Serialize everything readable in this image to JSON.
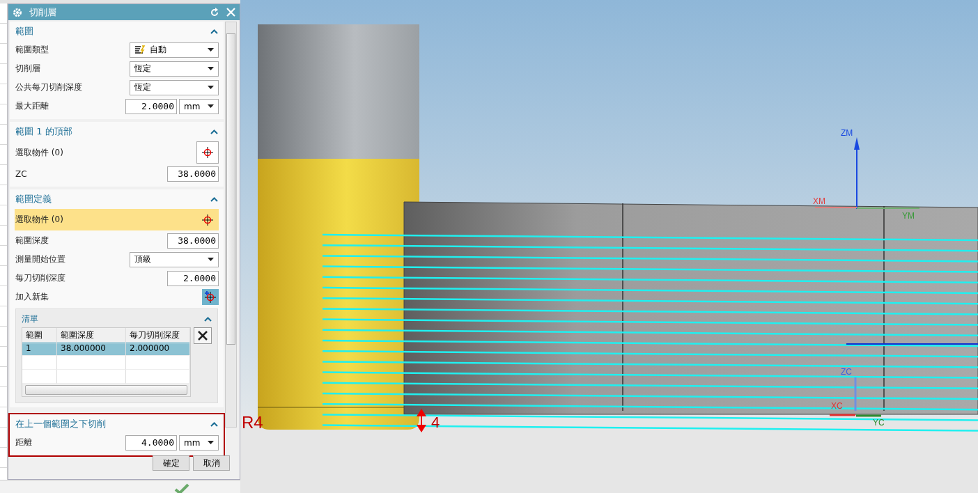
{
  "window": {
    "title": "切削層"
  },
  "sections": [
    {
      "title": "範圍",
      "expanded": true,
      "rows": [
        {
          "kind": "autoselect",
          "label": "範圍類型",
          "value": "自動"
        },
        {
          "kind": "select",
          "label": "切削層",
          "value": "恆定"
        },
        {
          "kind": "select",
          "label": "公共每刀切削深度",
          "value": "恆定"
        },
        {
          "kind": "unit",
          "label": "最大距離",
          "value": "2.0000",
          "unit": "mm"
        }
      ]
    },
    {
      "title": "範圍 1 的頂部",
      "expanded": true,
      "rows": [
        {
          "kind": "pick",
          "label": "選取物件 (0)",
          "selected": false
        },
        {
          "kind": "number",
          "label": "ZC",
          "value": "38.0000"
        }
      ]
    },
    {
      "title": "範圍定義",
      "expanded": true,
      "rows": [
        {
          "kind": "pick",
          "label": "選取物件 (0)",
          "selected": true
        },
        {
          "kind": "number",
          "label": "範圍深度",
          "value": "38.0000"
        },
        {
          "kind": "select",
          "label": "測量開始位置",
          "value": "頂級"
        },
        {
          "kind": "number",
          "label": "每刀切削深度",
          "value": "2.0000"
        },
        {
          "kind": "add",
          "label": "加入新集",
          "on": true
        }
      ],
      "list": {
        "title": "清單",
        "expanded": true,
        "columns": [
          "範圍",
          "範圍深度",
          "每刀切削深度"
        ],
        "rows": [
          {
            "cells": [
              "1",
              "38.000000",
              "2.000000"
            ],
            "selected": true
          }
        ]
      }
    },
    {
      "title": "在上一個範圍之下切削",
      "expanded": true,
      "annotated": true,
      "rows": [
        {
          "kind": "unit",
          "label": "距離",
          "value": "4.0000",
          "unit": "mm"
        }
      ]
    }
  ],
  "buttons": [
    "確定",
    "取消"
  ],
  "viewport": {
    "labels": [
      {
        "kind": "zm",
        "text": "ZM"
      },
      {
        "kind": "xm",
        "text": "XM"
      },
      {
        "kind": "ym",
        "text": "YM"
      },
      {
        "kind": "zc",
        "text": "ZC"
      },
      {
        "kind": "radius",
        "text": "R4"
      },
      {
        "kind": "depth",
        "text": "4"
      },
      {
        "kind": "xc",
        "text": "XC"
      },
      {
        "kind": "yc",
        "text": "YC"
      }
    ]
  }
}
